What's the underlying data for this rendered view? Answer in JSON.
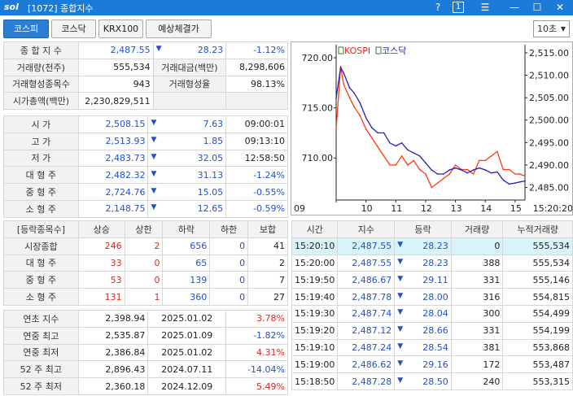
{
  "window": {
    "logo": "sol",
    "title": "[1072] 종합지수",
    "help": "?",
    "num": "1",
    "menu": "☰",
    "min": "—",
    "max": "☐",
    "close": "✕"
  },
  "tabs": [
    {
      "label": "코스피",
      "active": true
    },
    {
      "label": "코스닥"
    },
    {
      "label": "KRX100"
    },
    {
      "label": "예상체결가"
    }
  ],
  "interval": {
    "value": "10초"
  },
  "summary": {
    "r1": {
      "label": "종 합 지 수",
      "value": "2,487.55",
      "change": "28.23",
      "pct": "-1.12%"
    },
    "r2": {
      "label": "거래량(천주)",
      "value": "555,534",
      "label2": "거래대금(백만)",
      "value2": "8,298,606"
    },
    "r3": {
      "label": "거래형성종목수",
      "value": "943",
      "label2": "거래형성율",
      "value2": "98.13%"
    },
    "r4": {
      "label": "시가총액(백만)",
      "value": "2,230,829,511"
    }
  },
  "prices": [
    {
      "label": "시     가",
      "value": "2,508.15",
      "change": "7.63",
      "time": "09:00:01"
    },
    {
      "label": "고     가",
      "value": "2,513.93",
      "change": "1.85",
      "time": "09:13:10"
    },
    {
      "label": "저     가",
      "value": "2,483.73",
      "change": "32.05",
      "time": "12:58:50"
    },
    {
      "label": "대 형 주",
      "value": "2,482.32",
      "change": "31.13",
      "pct": "-1.24%"
    },
    {
      "label": "중 형 주",
      "value": "2,724.76",
      "change": "15.05",
      "pct": "-0.55%"
    },
    {
      "label": "소 형 주",
      "value": "2,148.75",
      "change": "12.65",
      "pct": "-0.59%"
    }
  ],
  "breadth": {
    "headers": [
      "[등락종목수]",
      "상승",
      "상한",
      "하락",
      "하한",
      "보합"
    ],
    "rows": [
      {
        "label": "시장종합",
        "up": "246",
        "uplimit": "2",
        "down": "656",
        "downlimit": "0",
        "flat": "41"
      },
      {
        "label": "대 형 주",
        "up": "33",
        "uplimit": "0",
        "down": "65",
        "downlimit": "0",
        "flat": "2"
      },
      {
        "label": "중 형 주",
        "up": "53",
        "uplimit": "0",
        "down": "139",
        "downlimit": "0",
        "flat": "7"
      },
      {
        "label": "소 형 주",
        "up": "131",
        "uplimit": "1",
        "down": "360",
        "downlimit": "0",
        "flat": "27"
      }
    ]
  },
  "hilo": [
    {
      "label": "연초  지수",
      "value": "2,398.94",
      "date": "2025.01.02",
      "pct": "3.78%",
      "color": "red"
    },
    {
      "label": "연중  최고",
      "value": "2,535.87",
      "date": "2025.01.09",
      "pct": "-1.82%",
      "color": "blue"
    },
    {
      "label": "연중  최저",
      "value": "2,386.84",
      "date": "2025.01.02",
      "pct": "4.31%",
      "color": "red"
    },
    {
      "label": "52 주 최고",
      "value": "2,896.43",
      "date": "2024.07.11",
      "pct": "-14.04%",
      "color": "blue"
    },
    {
      "label": "52 주 최저",
      "value": "2,360.18",
      "date": "2024.12.09",
      "pct": "5.49%",
      "color": "red"
    }
  ],
  "ticks": {
    "headers": [
      "시간",
      "지수",
      "등락",
      "거래량",
      "누적거래량"
    ],
    "rows": [
      {
        "time": "15:20:10",
        "index": "2,487.55",
        "change": "28.23",
        "vol": "0",
        "cum": "555,534"
      },
      {
        "time": "15:20:00",
        "index": "2,487.55",
        "change": "28.23",
        "vol": "388",
        "cum": "555,534"
      },
      {
        "time": "15:19:50",
        "index": "2,486.67",
        "change": "29.11",
        "vol": "331",
        "cum": "555,146"
      },
      {
        "time": "15:19:40",
        "index": "2,487.78",
        "change": "28.00",
        "vol": "316",
        "cum": "554,815"
      },
      {
        "time": "15:19:30",
        "index": "2,487.74",
        "change": "28.04",
        "vol": "300",
        "cum": "554,499"
      },
      {
        "time": "15:19:20",
        "index": "2,487.12",
        "change": "28.66",
        "vol": "331",
        "cum": "554,199"
      },
      {
        "time": "15:19:10",
        "index": "2,487.24",
        "change": "28.54",
        "vol": "381",
        "cum": "553,868"
      },
      {
        "time": "15:19:00",
        "index": "2,486.62",
        "change": "29.16",
        "vol": "172",
        "cum": "553,487"
      },
      {
        "time": "15:18:50",
        "index": "2,487.28",
        "change": "28.50",
        "vol": "240",
        "cum": "553,315"
      }
    ]
  },
  "chart_data": {
    "type": "line",
    "legend": [
      "KOSPI",
      "코스닥"
    ],
    "left_axis_ticks": [
      "720.00",
      "715.00",
      "710.00"
    ],
    "right_axis_ticks": [
      "2,515.00",
      "2,510.00",
      "2,505.00",
      "2,500.00",
      "2,495.00",
      "2,490.00",
      "2,485.00"
    ],
    "x_ticks": [
      "09",
      "10",
      "11",
      "12",
      "13",
      "14",
      "15",
      "15:20:20"
    ],
    "left_ylim": [
      705.8,
      721.3
    ],
    "right_ylim": [
      2482.2,
      2516.8
    ],
    "series": [
      {
        "name": "KOSPI",
        "axis": "right",
        "color": "#ff3a10",
        "x": [
          9.0,
          9.15,
          9.25,
          9.45,
          9.6,
          9.8,
          10.0,
          10.2,
          10.4,
          10.6,
          10.8,
          11.0,
          11.2,
          11.4,
          11.6,
          11.8,
          12.0,
          12.2,
          12.4,
          12.6,
          12.8,
          13.0,
          13.2,
          13.4,
          13.6,
          13.8,
          14.0,
          14.2,
          14.4,
          14.6,
          14.8,
          15.0,
          15.15,
          15.33
        ],
        "y": [
          2498,
          2512,
          2508,
          2505,
          2503,
          2501,
          2498,
          2496,
          2494,
          2492,
          2490,
          2490,
          2492,
          2490,
          2491,
          2489,
          2488,
          2485,
          2486,
          2487,
          2488,
          2490,
          2489,
          2489,
          2488,
          2491,
          2491,
          2492,
          2493,
          2489,
          2489,
          2488,
          2488,
          2487.55
        ]
      },
      {
        "name": "코스닥",
        "axis": "left",
        "color": "#2a1fb0",
        "x": [
          9.0,
          9.15,
          9.25,
          9.45,
          9.6,
          9.8,
          10.0,
          10.2,
          10.4,
          10.6,
          10.8,
          11.0,
          11.2,
          11.4,
          11.6,
          11.8,
          12.0,
          12.2,
          12.4,
          12.6,
          12.8,
          13.0,
          13.2,
          13.4,
          13.6,
          13.8,
          14.0,
          14.2,
          14.4,
          14.6,
          14.8,
          15.0,
          15.15,
          15.33
        ],
        "y": [
          716,
          719,
          718.5,
          717,
          716.5,
          715.5,
          714,
          713,
          712.5,
          712.5,
          711.5,
          711.2,
          711.5,
          710.8,
          710.5,
          710.2,
          709.5,
          708.8,
          708.4,
          708.4,
          708.8,
          709.0,
          708.8,
          708.5,
          708.8,
          709.0,
          708.8,
          708.5,
          708.6,
          707.8,
          707.4,
          707.5,
          707.6,
          707.7
        ]
      }
    ]
  }
}
